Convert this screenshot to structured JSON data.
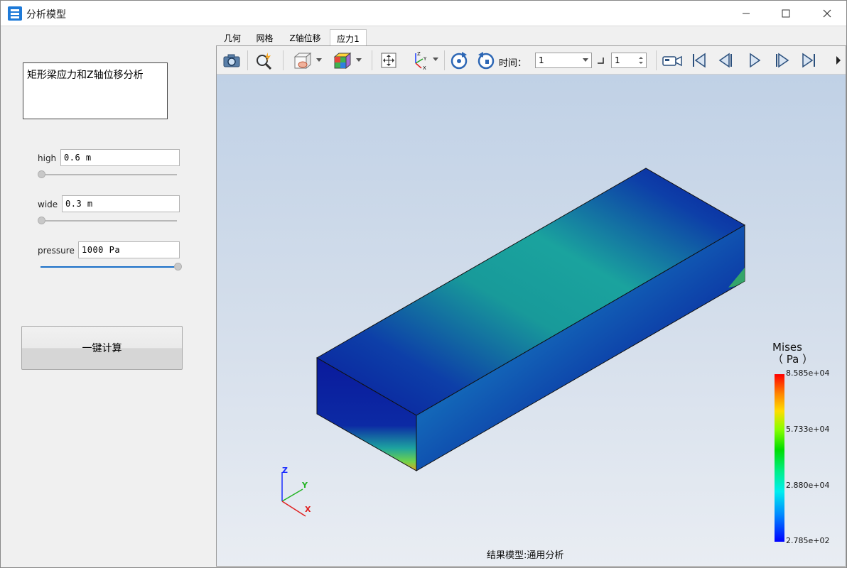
{
  "window": {
    "title": "分析模型"
  },
  "left_panel": {
    "description": "矩形梁应力和Z轴位移分析",
    "params": [
      {
        "label": "high",
        "value": "0.6 m",
        "slider_fraction": 0.0
      },
      {
        "label": "wide",
        "value": "0.3 m",
        "slider_fraction": 0.0
      },
      {
        "label": "pressure",
        "value": "1000 Pa",
        "slider_fraction": 1.0
      }
    ],
    "calc_button": "一键计算"
  },
  "tabs": [
    {
      "label": "几何",
      "active": false
    },
    {
      "label": "网格",
      "active": false
    },
    {
      "label": "Z轴位移",
      "active": false
    },
    {
      "label": "应力1",
      "active": true
    }
  ],
  "toolbar": {
    "icons": [
      "camera-icon",
      "zoom-icon",
      "display-mode-icon",
      "color-cube-icon",
      "fit-view-icon",
      "axes-orient-icon",
      "rotate-cw-icon",
      "rotate-ccw-icon",
      "record-icon",
      "first-frame-icon",
      "step-back-icon",
      "play-icon",
      "step-forward-icon",
      "last-frame-icon"
    ],
    "time_label": "时间：",
    "time_value": "1",
    "step_value": "1"
  },
  "viewport": {
    "model_label": "结果模型:通用分析",
    "axes": {
      "z": "Z",
      "y": "Y",
      "x": "X"
    }
  },
  "legend": {
    "title_line1": "Mises",
    "title_line2": "（ Pa ）",
    "ticks": [
      "8.585e+04",
      "5.733e+04",
      "2.880e+04",
      "2.785e+02"
    ],
    "colors": {
      "max": "#ff0000",
      "mid": "#00dd00",
      "min": "#0000ff"
    }
  }
}
